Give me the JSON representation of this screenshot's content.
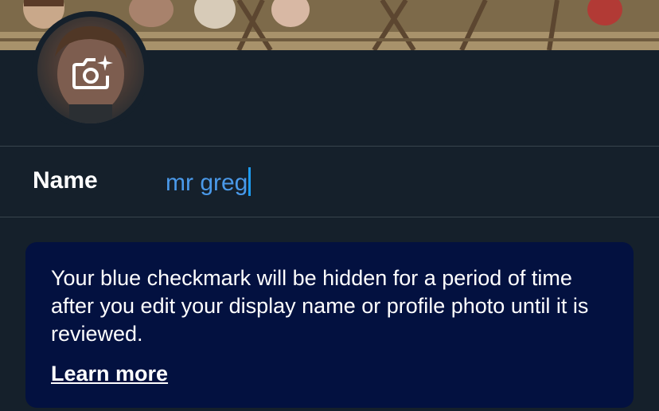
{
  "name_field": {
    "label": "Name",
    "value": "mr greg"
  },
  "notice": {
    "message": "Your blue checkmark will be hidden for a period of time after you edit your display name or profile photo until it is reviewed.",
    "link_label": "Learn more"
  },
  "icons": {
    "avatar_overlay": "camera-plus-icon"
  },
  "colors": {
    "background": "#15202b",
    "input_text": "#4a99e9",
    "notice_background": "#031140",
    "divider": "#38444d"
  }
}
